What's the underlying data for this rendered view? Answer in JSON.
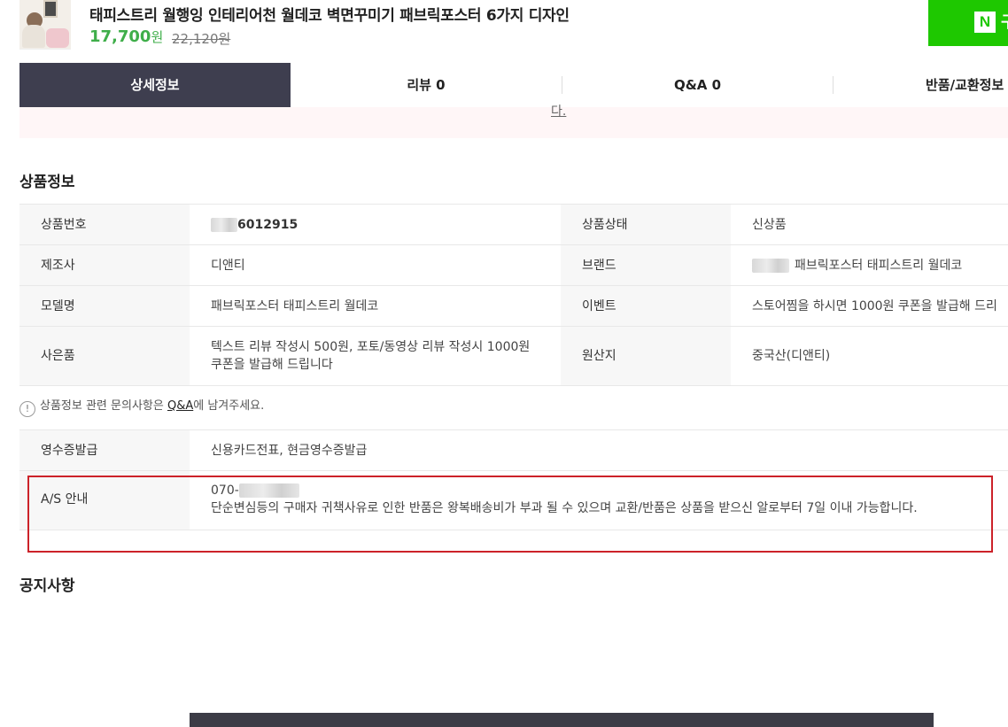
{
  "product": {
    "title": "태피스트리 월행잉 인테리어천 월데코 벽면꾸미기 패브릭포스터 6가지 디자인",
    "price": "17,700",
    "price_unit": "원",
    "original_price": "22,120원",
    "pay_button_logo": "N",
    "pay_button_more": "구"
  },
  "tabs": [
    {
      "label": "상세정보"
    },
    {
      "label": "리뷰 0"
    },
    {
      "label": "Q&A 0"
    },
    {
      "label": "반품/교환정보"
    }
  ],
  "pink_strip_text": "다.",
  "product_info": {
    "title": "상품정보",
    "rows": [
      {
        "label1": "상품번호",
        "value1": "6012915",
        "label2": "상품상태",
        "value2": "신상품"
      },
      {
        "label1": "제조사",
        "value1": "디앤티",
        "label2": "브랜드",
        "value2": "패브릭포스터 태피스트리 월데코"
      },
      {
        "label1": "모델명",
        "value1": "패브릭포스터 태피스트리 월데코",
        "label2": "이벤트",
        "value2": "스토어찜을 하시면 1000원 쿠폰을 발급해 드리"
      },
      {
        "label1": "사은품",
        "value1": "텍스트 리뷰 작성시 500원, 포토/동영상 리뷰 작성시 1000원 쿠폰을 발급해 드립니다",
        "label2": "원산지",
        "value2": "중국산(디앤티)"
      }
    ],
    "notice_icon": "!",
    "notice_before": "상품정보 관련 문의사항은 ",
    "notice_link": "Q&A",
    "notice_after": "에 남겨주세요."
  },
  "extra_info": {
    "receipt_label": "영수증발급",
    "receipt_value": "신용카드전표, 현금영수증발급",
    "as_label": "A/S 안내",
    "as_phone": "070-",
    "as_text": "단순변심등의 구매자 귀책사유로 인한 반품은 왕복배송비가 부과 될 수 있으며 교환/반품은 상품을 받으신 알로부터 7일 이내 가능합니다."
  },
  "notice_section": {
    "title": "공지사항"
  },
  "colors": {
    "accent_green": "#3fae4a",
    "npay_green": "#1ec800",
    "tab_active_bg": "#3e3e4f",
    "highlight_red": "#cc2229"
  }
}
